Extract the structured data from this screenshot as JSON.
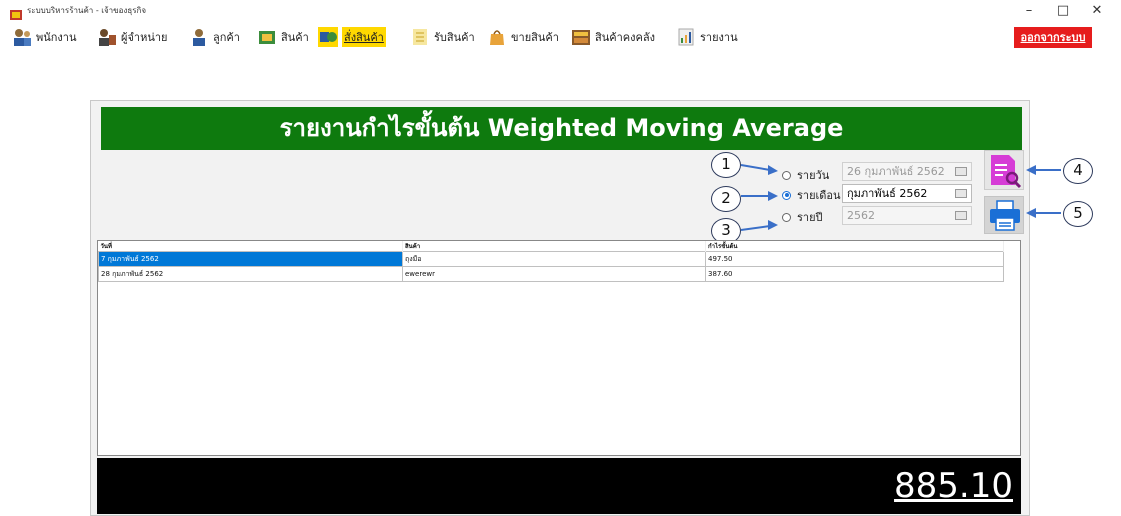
{
  "window": {
    "title": "ระบบบริหารร้านค้า - เจ้าของธุรกิจ",
    "minimize": "–",
    "maximize": "□",
    "close": "✕"
  },
  "menu": [
    {
      "label": "พนักงาน",
      "icon": "employee-icon"
    },
    {
      "label": "ผู้จำหน่าย",
      "icon": "supplier-icon"
    },
    {
      "label": "ลูกค้า",
      "icon": "customer-icon"
    },
    {
      "label": "สินค้า",
      "icon": "product-icon"
    },
    {
      "label": "สั่งสินค้า",
      "icon": "order-icon",
      "active": true
    },
    {
      "label": "รับสินค้า",
      "icon": "receive-icon"
    },
    {
      "label": "ขายสินค้า",
      "icon": "sell-icon"
    },
    {
      "label": "สินค้าคงคลัง",
      "icon": "inventory-icon"
    },
    {
      "label": "รายงาน",
      "icon": "report-icon"
    }
  ],
  "logout_label": "ออกจากระบบ",
  "report": {
    "title": "รายงานกำไรขั้นต้น Weighted Moving Average",
    "options": [
      {
        "label": "รายวัน",
        "value": "26 กุมภาพันธ์  2562",
        "checked": false,
        "enabled": false
      },
      {
        "label": "รายเดือน",
        "value": "กุมภาพันธ์  2562",
        "checked": true,
        "enabled": true
      },
      {
        "label": "รายปี",
        "value": "2562",
        "checked": false,
        "enabled": false
      }
    ],
    "callouts": [
      "1",
      "2",
      "3",
      "4",
      "5"
    ],
    "columns": [
      "วันที่",
      "สินค้า",
      "กำไรขั้นต้น"
    ],
    "rows": [
      {
        "date": "7 กุมภาพันธ์ 2562",
        "product": "ถุงมือ",
        "profit": "497.50"
      },
      {
        "date": "28 กุมภาพันธ์ 2562",
        "product": "ewerewr",
        "profit": "387.60"
      }
    ],
    "total": "885.10"
  },
  "colors": {
    "header_green": "#0e7a0e",
    "active_menu": "#ffd800",
    "logout_red": "#e61d1d",
    "selection_blue": "#0078d7",
    "preview_magenta": "#d63cd6",
    "print_blue": "#1a6fd6"
  }
}
